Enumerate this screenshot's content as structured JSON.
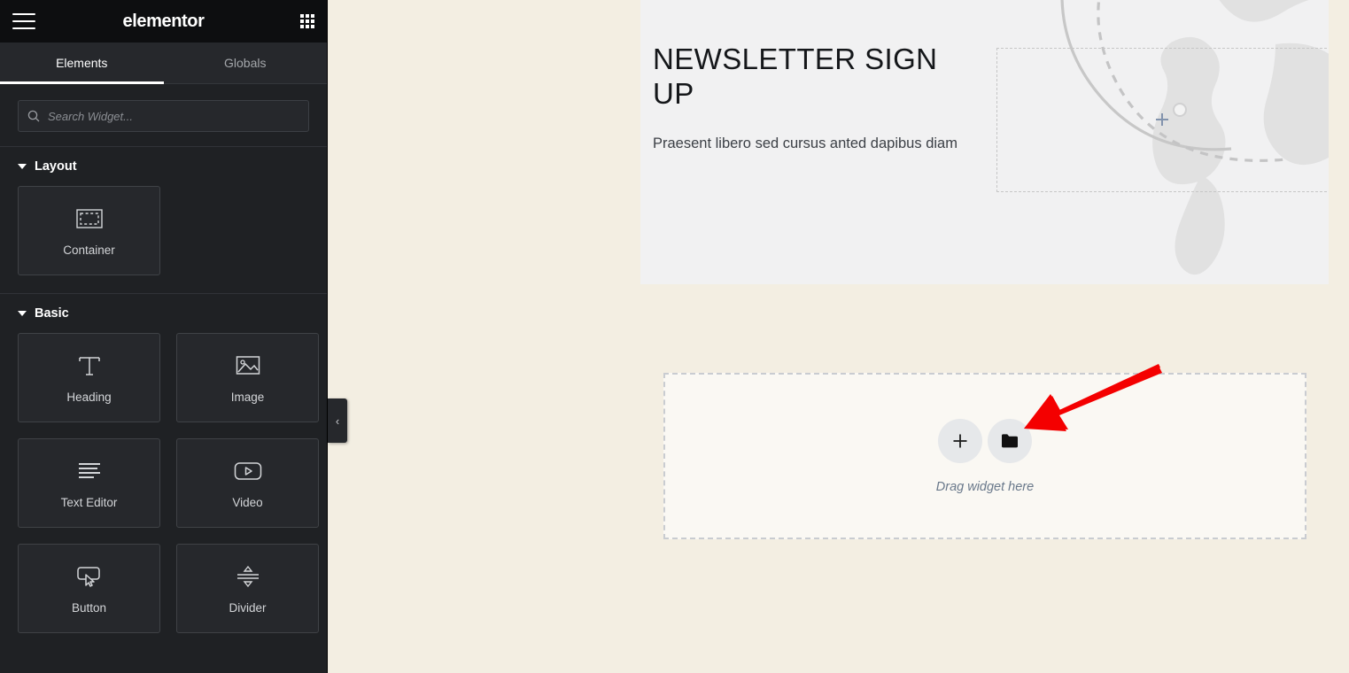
{
  "panel": {
    "header": {
      "brand": "elementor",
      "menu_icon": "hamburger-menu-icon",
      "apps_icon": "grid-apps-icon"
    },
    "tabs": [
      {
        "label": "Elements",
        "active": true
      },
      {
        "label": "Globals",
        "active": false
      }
    ],
    "search": {
      "placeholder": "Search Widget...",
      "value": "",
      "icon": "search-icon"
    },
    "sections": [
      {
        "title": "Layout",
        "widgets": [
          {
            "label": "Container",
            "icon": "container-icon"
          }
        ]
      },
      {
        "title": "Basic",
        "widgets": [
          {
            "label": "Heading",
            "icon": "heading-text-icon"
          },
          {
            "label": "Image",
            "icon": "image-picture-icon"
          },
          {
            "label": "Text Editor",
            "icon": "text-lines-icon"
          },
          {
            "label": "Video",
            "icon": "video-play-icon"
          },
          {
            "label": "Button",
            "icon": "button-cursor-icon"
          },
          {
            "label": "Divider",
            "icon": "divider-arrows-icon"
          }
        ]
      }
    ],
    "collapse_handle": {
      "icon": "chevron-left-icon",
      "glyph": "‹"
    }
  },
  "canvas": {
    "hero": {
      "title": "NEWSLETTER SIGN UP",
      "subtitle": "Praesent libero sed cursus anted dapibus diam",
      "placeholder_box": "empty-dashed-placeholder",
      "graphic": "world-globe-flight-path-graphic",
      "marker": "plus-marker"
    },
    "dropzone": {
      "hint": "Drag widget here",
      "add_button_icon": "plus-icon",
      "folder_button_icon": "folder-templates-icon"
    },
    "annotation": {
      "arrow": "red-pointer-arrow",
      "color": "#f40000"
    }
  },
  "colors": {
    "panel_bg": "#1f2124",
    "panel_header_bg": "#0d0e10",
    "canvas_bg": "#f3eee2",
    "hero_bg": "#f1f1f2",
    "dropzone_bg": "#faf8f3",
    "accent_red": "#f40000"
  }
}
